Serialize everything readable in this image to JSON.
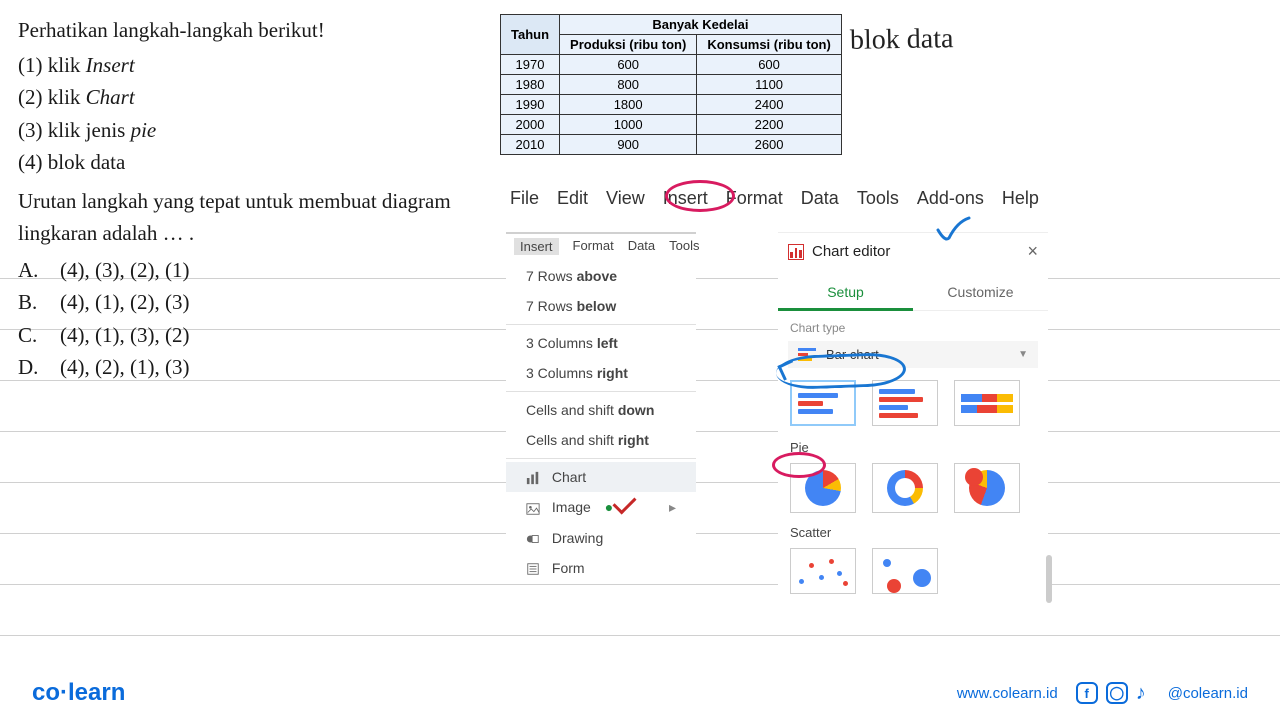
{
  "question": {
    "title": "Perhatikan langkah-langkah berikut!",
    "steps": [
      {
        "n": "(1)",
        "pre": "klik ",
        "it": "Insert"
      },
      {
        "n": "(2)",
        "pre": "klik ",
        "it": "Chart"
      },
      {
        "n": "(3)",
        "pre": "klik jenis ",
        "it": "pie"
      },
      {
        "n": "(4)",
        "pre": "blok data",
        "it": ""
      }
    ],
    "prompt": "Urutan langkah yang tepat untuk membuat diagram lingkaran adalah … .",
    "options": {
      "A": "(4), (3), (2), (1)",
      "B": "(4), (1), (2), (3)",
      "C": "(4), (1), (3), (2)",
      "D": "(4), (2), (1), (3)"
    }
  },
  "table": {
    "col_year": "Tahun",
    "group": "Banyak Kedelai",
    "col_prod": "Produksi (ribu ton)",
    "col_kons": "Konsumsi (ribu ton)",
    "rows": [
      {
        "y": "1970",
        "p": "600",
        "k": "600"
      },
      {
        "y": "1980",
        "p": "800",
        "k": "1100"
      },
      {
        "y": "1990",
        "p": "1800",
        "k": "2400"
      },
      {
        "y": "2000",
        "p": "1000",
        "k": "2200"
      },
      {
        "y": "2010",
        "p": "900",
        "k": "2600"
      }
    ]
  },
  "handwriting": {
    "blok": "blok data"
  },
  "menubar": [
    "File",
    "Edit",
    "View",
    "Insert",
    "Format",
    "Data",
    "Tools",
    "Add-ons",
    "Help"
  ],
  "insert_menu": {
    "tabs": [
      "Insert",
      "Format",
      "Data",
      "Tools"
    ],
    "rows_above": "7 Rows above",
    "rows_below": "7 Rows below",
    "cols_left": "3 Columns left",
    "cols_right": "3 Columns right",
    "cells_down": "Cells and shift down",
    "cells_right": "Cells and shift right",
    "chart": "Chart",
    "image": "Image",
    "drawing": "Drawing",
    "form": "Form"
  },
  "chart_editor": {
    "title": "Chart editor",
    "tab_setup": "Setup",
    "tab_customize": "Customize",
    "chart_type_label": "Chart type",
    "selected_type": "Bar chart",
    "section_pie": "Pie",
    "section_scatter": "Scatter"
  },
  "footer": {
    "brand_a": "co",
    "brand_b": "learn",
    "site": "www.colearn.id",
    "handle": "@colearn.id"
  }
}
